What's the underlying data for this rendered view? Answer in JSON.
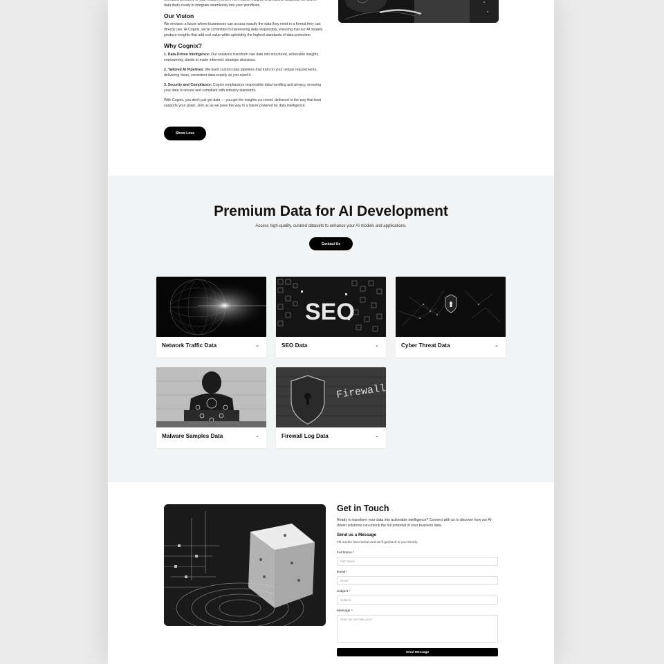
{
  "about": {
    "intro_text": "formatted precisely to your requirements. From market insights to predictive analytics, we deliver data that's ready to integrate seamlessly into your workflows.",
    "vision_heading": "Our Vision",
    "vision_text": "We envision a future where businesses can access exactly the data they need in a format they can directly use. At Cognix, we're committed to harnessing data responsibly, ensuring that our AI models produce insights that add real value while upholding the highest standards of data protection.",
    "why_heading": "Why Cognix?",
    "points": [
      {
        "title": "1. Data-Driven Intelligence:",
        "text": " Our solutions transform raw data into structured, actionable insights, empowering clients to make informed, strategic decisions."
      },
      {
        "title": "2. Tailored AI Pipelines:",
        "text": " We build custom data pipelines that train on your unique requirements, delivering clean, consistent data exactly as you need it."
      },
      {
        "title": "3. Security and Compliance:",
        "text": " Cognix emphasizes responsible data handling and privacy, ensuring your data is secure and compliant with industry standards."
      }
    ],
    "closing_text": "With Cognix, you don't just get data — you get the insights you need, delivered in the way that best supports your goals. Join us as we pave the way to a future powered by data intelligence.",
    "show_less_label": "Show Less"
  },
  "premium": {
    "title": "Premium Data for AI Development",
    "subtitle": "Access high-quality, curated datasets to enhance your AI models and applications.",
    "contact_label": "Contact Us",
    "cards": [
      {
        "label": "Network Traffic Data",
        "icon": "chevron-down-icon"
      },
      {
        "label": "SEO Data",
        "icon": "chevron-down-icon"
      },
      {
        "label": "Cyber Threat Data",
        "icon": "chevron-down-icon"
      },
      {
        "label": "Malware Samples Data",
        "icon": "chevron-down-icon"
      },
      {
        "label": "Firewall Log Data",
        "icon": "chevron-down-icon"
      }
    ],
    "seo_image_text": "SEO",
    "firewall_image_text": "Firewall"
  },
  "contact": {
    "title": "Get in Touch",
    "description": "Ready to transform your data into actionable intelligence? Connect with us to discover how our AI-driven solutions can unlock the full potential of your business data.",
    "form_title": "Send us a Message",
    "form_subtitle": "Fill out the form below and we'll get back to you shortly.",
    "fields": {
      "full_name": {
        "label": "Full Name *",
        "placeholder": "Full Name"
      },
      "email": {
        "label": "Email *",
        "placeholder": "Email"
      },
      "subject": {
        "label": "Subject *",
        "placeholder": "Subject"
      },
      "message": {
        "label": "Message *",
        "placeholder": "How can we help you?"
      }
    },
    "submit_label": "Send Message"
  }
}
